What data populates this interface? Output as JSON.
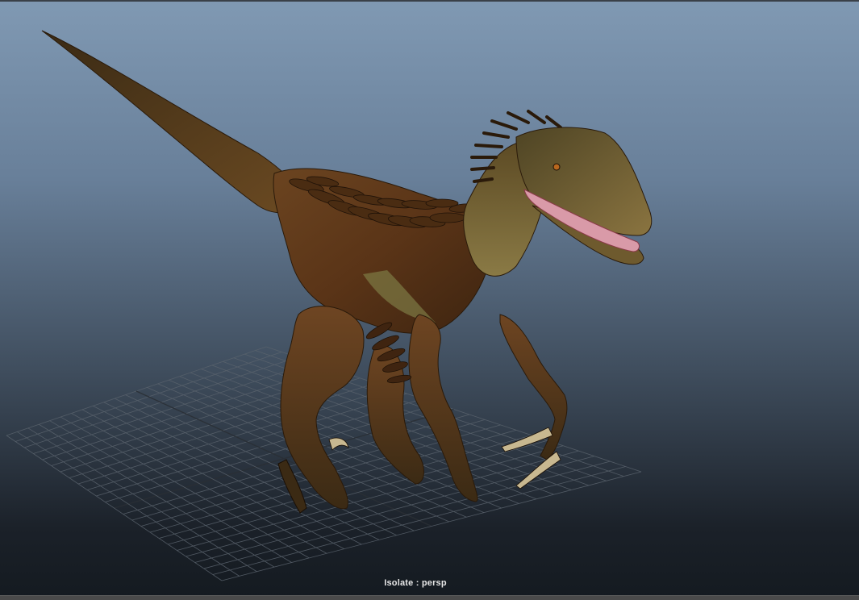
{
  "viewport": {
    "camera_label": "Isolate : persp",
    "background_top_color": "#8099b3",
    "background_bottom_color": "#141a20",
    "grid_color": "#5a636d"
  },
  "model": {
    "body_color": "#5a3417",
    "belly_color": "#8a7a45",
    "mouth_color": "#d99aa8"
  }
}
